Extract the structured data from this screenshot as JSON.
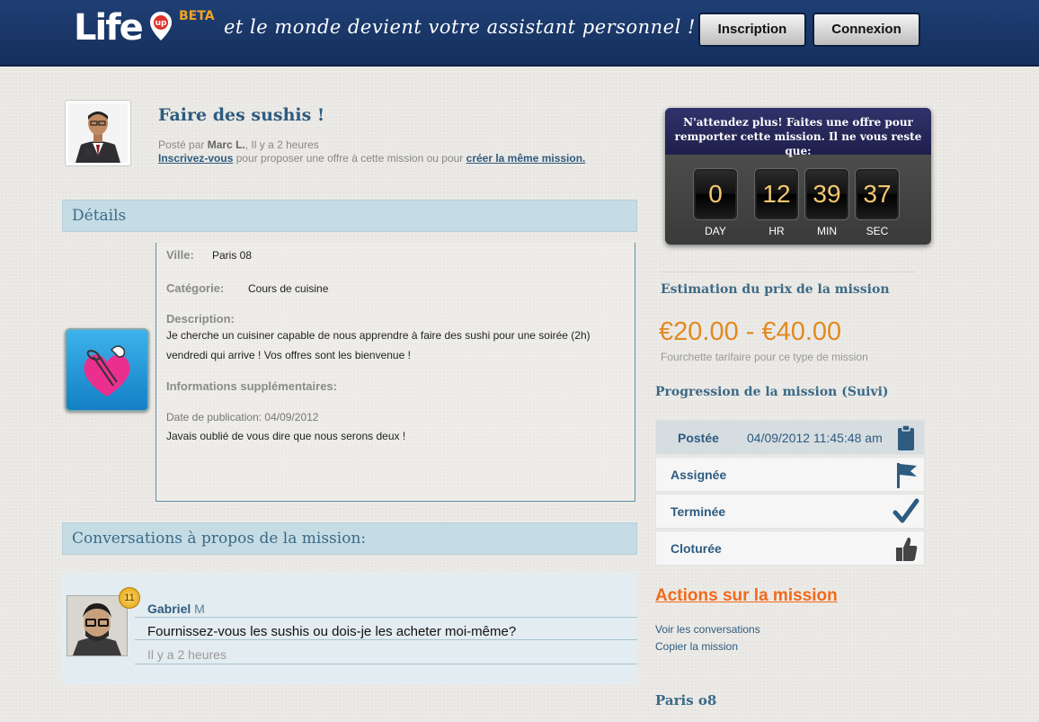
{
  "header": {
    "logo_text": "Life",
    "logo_badge": "up",
    "beta_label": "BETA",
    "tagline": "et le monde devient votre assistant personnel !",
    "signup_label": "Inscription",
    "login_label": "Connexion"
  },
  "mission": {
    "title": "Faire des sushis !",
    "posted_prefix": "Posté par",
    "author": "Marc L.",
    "posted_suffix": ", Il y a 2 heures",
    "signup_link": "Inscrivez-vous",
    "invite_middle": " pour proposer une offre à cette mission ou pour ",
    "create_link": "créer la même mission."
  },
  "details": {
    "section_title": "Détails",
    "city_label": "Ville:",
    "city_value": "Paris 08",
    "category_label": "Catégorie:",
    "category_value": "Cours de cuisine",
    "description_label": "Description:",
    "description_line1": "Je cherche un cuisiner capable de nous apprendre à faire des sushi pour une soirée (2h)",
    "description_line2": "vendredi qui arrive ! Vos offres sont les bienvenue !",
    "extra_label": "Informations supplémentaires:",
    "pub_date": "Date de publication: 04/09/2012",
    "extra_text": "Javais oublié de vous dire que nous serons deux !"
  },
  "conversations": {
    "section_title": "Conversations à propos de la mission:",
    "badge_count": "11",
    "first_name": "Gabriel",
    "last_initial": " M",
    "message": "Fournissez-vous les sushis ou dois-je les acheter moi-même?",
    "time": "Il y a 2 heures"
  },
  "countdown": {
    "header_line1": "N'attendez plus! Faites une offre pour",
    "header_line2": "remporter cette mission. Il ne vous reste que:",
    "tiles": [
      {
        "value": "0",
        "label": "DAY"
      },
      {
        "value": "12",
        "label": "HR"
      },
      {
        "value": "39",
        "label": "MIN"
      },
      {
        "value": "37",
        "label": "SEC"
      }
    ]
  },
  "estimate": {
    "title": "Estimation du prix de la mission",
    "price": "€20.00 - €40.00",
    "subtitle": "Fourchette tarifaire pour ce type de mission"
  },
  "progress": {
    "title": "Progression de la mission (Suivi)",
    "steps": [
      {
        "label": "Postée",
        "date": "04/09/2012 11:45:48 am",
        "icon": "clipboard-icon"
      },
      {
        "label": "Assignée",
        "date": "",
        "icon": "flag-icon"
      },
      {
        "label": "Terminée",
        "date": "",
        "icon": "checkmark-icon"
      },
      {
        "label": "Cloturée",
        "date": "",
        "icon": "thumbs-up-icon"
      }
    ]
  },
  "actions": {
    "title": "Actions sur la mission",
    "view_conversations": "Voir les conversations",
    "copy_mission": "Copier la mission"
  },
  "city_section_title": "Paris o8",
  "colors": {
    "header_bg": "#1a3868",
    "accent_blue": "#2e5b80",
    "price_orange": "#e08a22",
    "actions_orange": "#f26a1b",
    "countdown_digit": "#f4c670"
  }
}
